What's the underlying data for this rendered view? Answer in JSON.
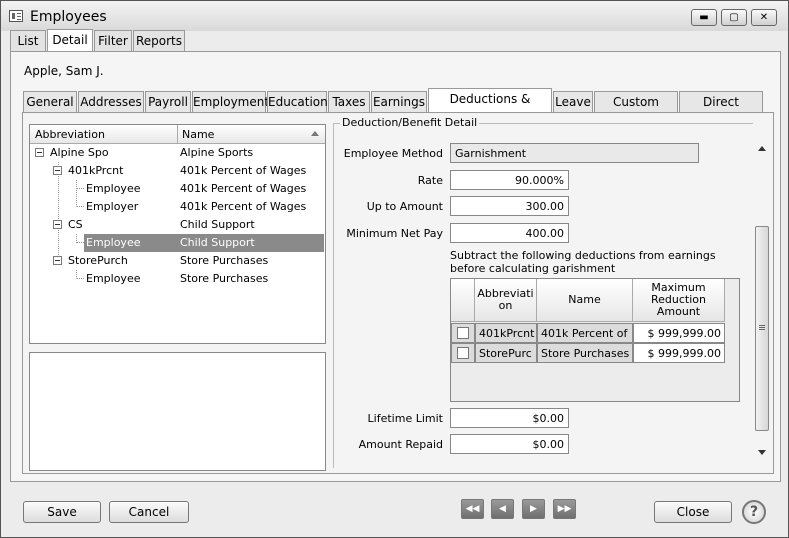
{
  "window": {
    "title": "Employees",
    "minimize": "▬",
    "maximize": "▢",
    "close": "✕"
  },
  "top_tabs": [
    "List",
    "Detail",
    "Filter",
    "Reports"
  ],
  "employee_name": "Apple, Sam J.",
  "sub_tabs": [
    "General",
    "Addresses",
    "Payroll",
    "Employment",
    "Education",
    "Taxes",
    "Earnings",
    "Deductions & Benefits",
    "Leave",
    "Custom Fields",
    "Direct Deposit"
  ],
  "tree": {
    "headers": {
      "abbreviation": "Abbreviation",
      "name": "Name"
    },
    "rows": [
      {
        "abbr": "Alpine Spo",
        "name": "Alpine Sports"
      },
      {
        "abbr": "401kPrcnt",
        "name": "401k Percent of Wages"
      },
      {
        "abbr": "Employee",
        "name": "401k Percent of Wages"
      },
      {
        "abbr": "Employer",
        "name": "401k Percent of Wages"
      },
      {
        "abbr": "CS",
        "name": "Child Support"
      },
      {
        "abbr": "Employee",
        "name": "Child Support"
      },
      {
        "abbr": "StorePurch",
        "name": "Store Purchases"
      },
      {
        "abbr": "Employee",
        "name": "Store Purchases"
      }
    ]
  },
  "detail": {
    "group_label": "Deduction/Benefit Detail",
    "employee_method_label": "Employee Method",
    "employee_method_value": "Garnishment",
    "rate_label": "Rate",
    "rate_value": "90.000%",
    "up_to_amount_label": "Up to Amount",
    "up_to_amount_value": "300.00",
    "min_net_pay_label": "Minimum Net Pay",
    "min_net_pay_value": "400.00",
    "subtract_text": "Subtract the following deductions from earnings before calculating garishment",
    "grid": {
      "headers": {
        "abbreviation": "Abbreviati on",
        "name": "Name",
        "max": "Maximum Reduction Amount"
      },
      "rows": [
        {
          "abbr": "401kPrcnt",
          "name": "401k Percent of",
          "max": "$ 999,999.00"
        },
        {
          "abbr": "StorePurc",
          "name": "Store Purchases",
          "max": "$ 999,999.00"
        }
      ]
    },
    "lifetime_limit_label": "Lifetime Limit",
    "lifetime_limit_value": "$0.00",
    "amount_repaid_label": "Amount Repaid",
    "amount_repaid_value": "$0.00"
  },
  "footer": {
    "save": "Save",
    "cancel": "Cancel",
    "close": "Close",
    "first": "◀◀",
    "prev": "◀",
    "next": "▶",
    "last": "▶▶",
    "help": "?"
  }
}
